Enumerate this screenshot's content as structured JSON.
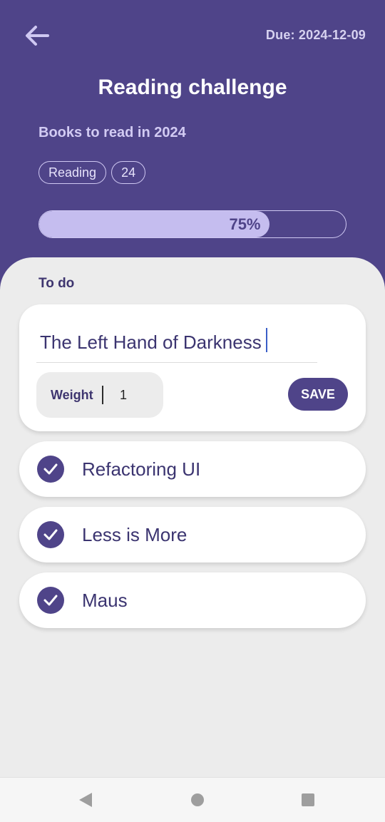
{
  "header": {
    "due_text": "Due: 2024-12-09",
    "title": "Reading challenge",
    "subtitle": "Books to read in 2024",
    "tags": [
      "Reading",
      "24"
    ],
    "progress": {
      "fraction": 0.75,
      "label": "75%"
    }
  },
  "todo": {
    "section_label": "To do",
    "edit": {
      "title_value": "The Left Hand of Darkness",
      "weight_label": "Weight",
      "weight_value": "1",
      "save_label": "SAVE"
    },
    "items": [
      {
        "label": "Refactoring UI",
        "checked": true
      },
      {
        "label": "Less is More",
        "checked": true
      },
      {
        "label": "Maus",
        "checked": true
      }
    ]
  },
  "icons": {
    "back": "arrow-left-icon",
    "check": "check-icon",
    "nav_back": "triangle-back-icon",
    "nav_home": "circle-home-icon",
    "nav_recents": "square-recents-icon"
  },
  "colors": {
    "primary": "#4f4489",
    "progress_fill": "#c5bdef",
    "sheet_bg": "#ececec",
    "text_dark": "#3b3470"
  }
}
